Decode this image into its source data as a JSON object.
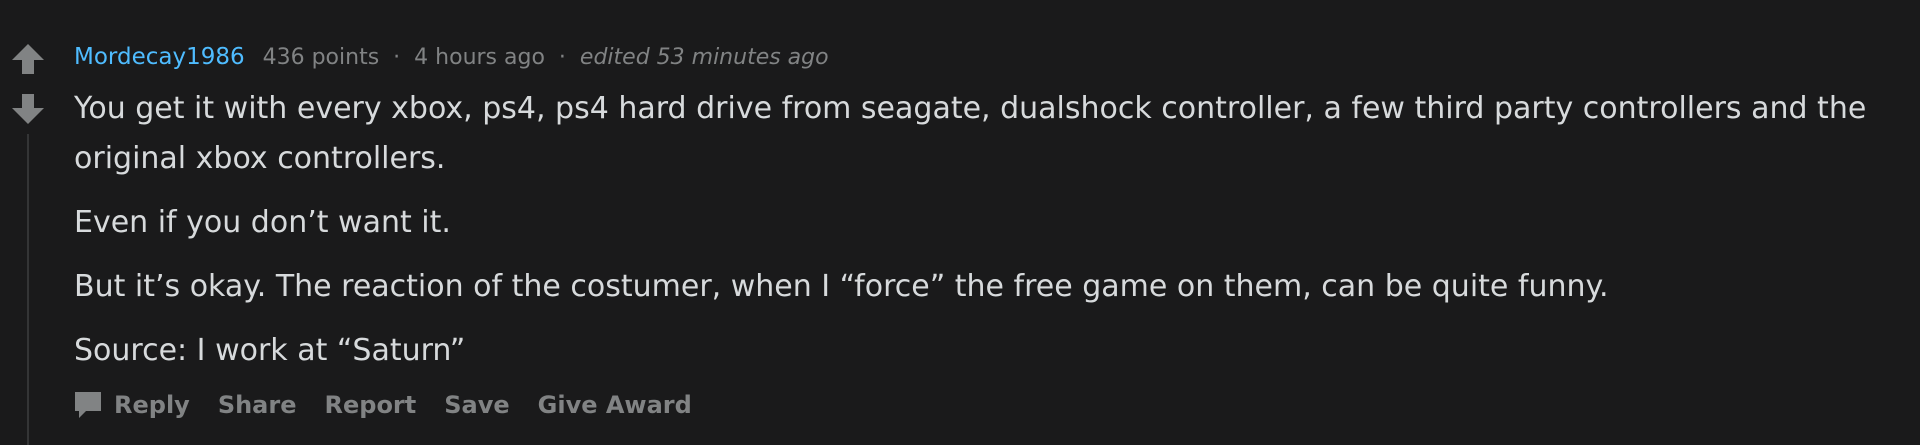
{
  "comment": {
    "author": "Mordecay1986",
    "points": "436 points",
    "separator": "·",
    "time": "4 hours ago",
    "edited": "edited 53 minutes ago",
    "paragraphs": [
      "You get it with every xbox, ps4, ps4 hard drive from seagate, dualshock controller, a few third party controllers and the original xbox controllers.",
      "Even if you don’t want it.",
      "But it’s okay. The reaction of the costumer, when I “force” the free game on them, can be quite funny.",
      "Source: I work at “Saturn”"
    ]
  },
  "actions": {
    "reply": "Reply",
    "share": "Share",
    "report": "Report",
    "save": "Save",
    "give_award": "Give Award"
  },
  "icons": {
    "upvote": "upvote-arrow-icon",
    "downvote": "downvote-arrow-icon",
    "reply": "speech-bubble-icon"
  },
  "colors": {
    "background": "#1a1a1b",
    "username": "#4fbcff",
    "body_text": "#d7dadc",
    "meta_text": "#818384",
    "thread_line": "#343536"
  }
}
